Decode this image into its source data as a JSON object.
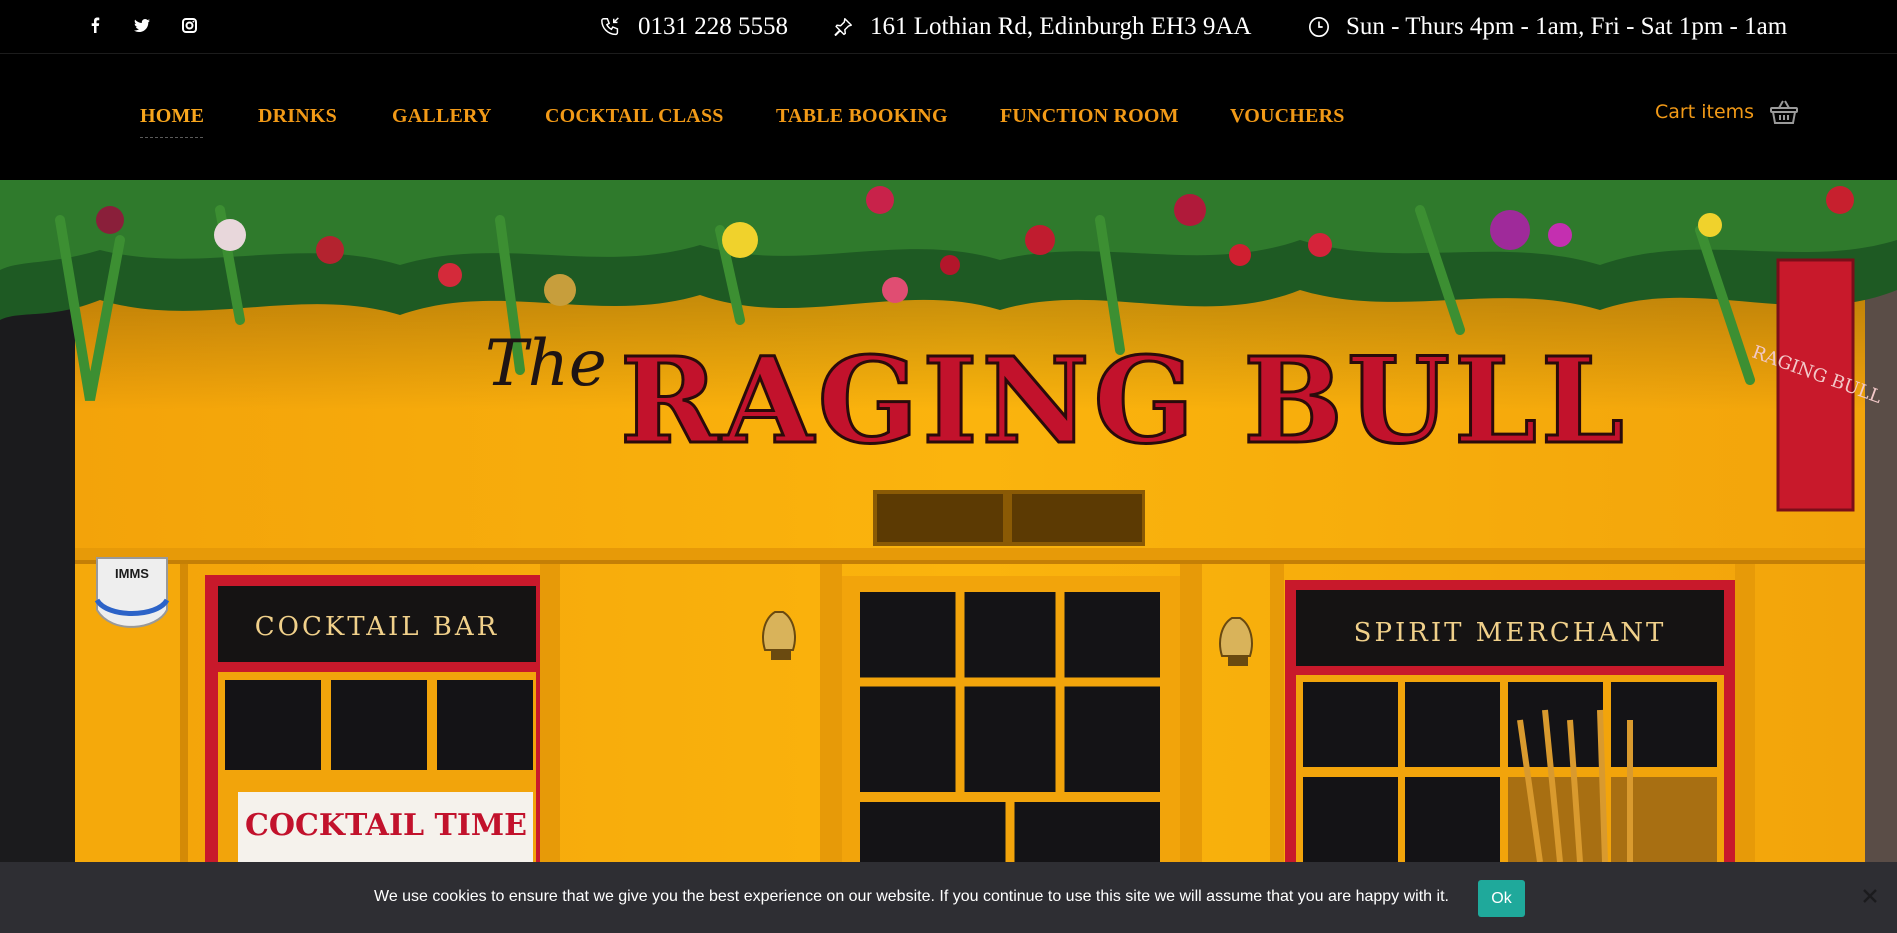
{
  "topbar": {
    "social": [
      {
        "name": "facebook-icon",
        "glyph": "f"
      },
      {
        "name": "twitter-icon",
        "glyph": "t"
      },
      {
        "name": "instagram-icon",
        "glyph": "ig"
      }
    ],
    "phone": "0131 228 5558",
    "address": "161 Lothian Rd, Edinburgh EH3 9AA",
    "hours": "Sun - Thurs 4pm - 1am, Fri - Sat 1pm - 1am"
  },
  "nav": {
    "items": [
      {
        "label": "HOME",
        "active": true
      },
      {
        "label": "DRINKS"
      },
      {
        "label": "GALLERY"
      },
      {
        "label": "COCKTAIL CLASS"
      },
      {
        "label": "TABLE BOOKING"
      },
      {
        "label": "FUNCTION ROOM"
      },
      {
        "label": "VOUCHERS"
      }
    ],
    "cart_label": "Cart items"
  },
  "hero": {
    "sign_the": "The",
    "sign_name": "RAGING BULL",
    "panel_left": "COCKTAIL BAR",
    "panel_right": "SPIRIT MERCHANT",
    "window_poster": "COCKTAIL TIME",
    "alarm_label": "IMMS",
    "side_sign": "RAGING BULL"
  },
  "cookie": {
    "text": "We use cookies to ensure that we give you the best experience on our website. If you continue to use this site we will assume that you are happy with it.",
    "ok_label": "Ok"
  },
  "colors": {
    "accent": "#f29a17",
    "facade": "#f6ac0b",
    "sign_red": "#c2122c",
    "cookie_bg": "#2e2e33",
    "ok_button": "#1fa99b"
  }
}
